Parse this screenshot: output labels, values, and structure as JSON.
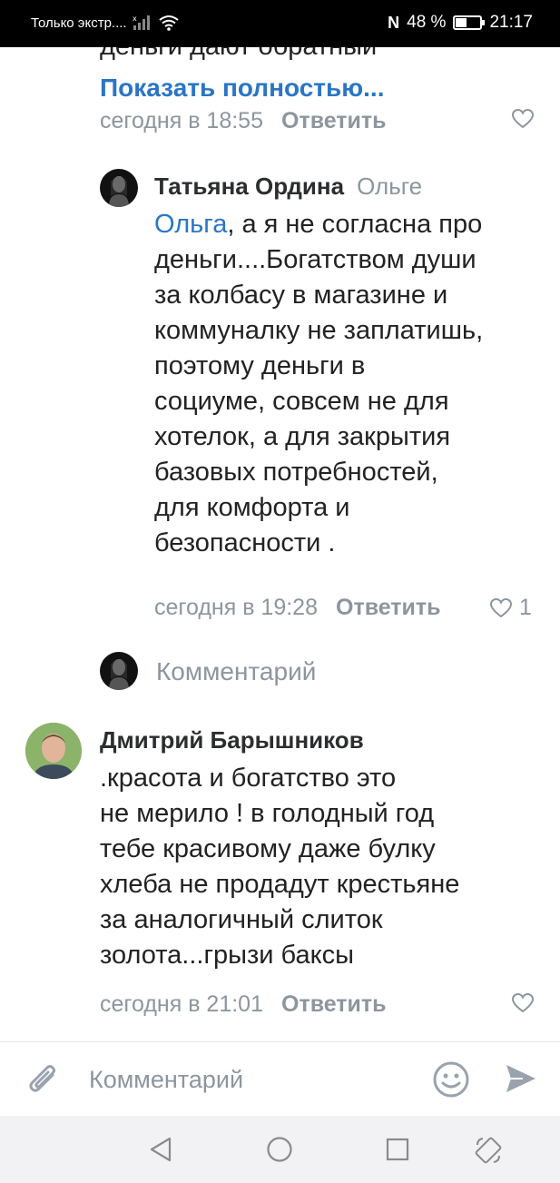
{
  "status_bar": {
    "carrier_text": "Только экстр....",
    "battery_text": "48 %",
    "battery_level": 0.48,
    "time": "21:17"
  },
  "comments": [
    {
      "truncated_line": "деньги дают обратный",
      "show_more": "Показать полностью...",
      "time": "сегодня в 18:55",
      "reply": "Ответить"
    },
    {
      "author": "Татьяна Ордина",
      "to": "Ольге",
      "mention": "Ольга",
      "lines": [
        ", а я не согласна про",
        "деньги....Богатством души",
        "за колбасу в магазине и",
        "коммуналку не заплатишь,",
        "поэтому деньги в",
        "социуме, совсем не для",
        "хотелок, а для закрытия",
        "базовых потребностей,",
        "для комфорта и",
        "безопасности ."
      ],
      "time": "сегодня в 19:28",
      "reply": "Ответить",
      "likes": "1"
    },
    {
      "author": "Дмитрий Барышников",
      "lines": [
        ".красота и богатство это",
        "не мерило ! в голодный год",
        "тебе красивому даже булку",
        "хлеба не продадут крестьяне",
        "за аналогичный слиток",
        "золота...грызи баксы"
      ],
      "time": "сегодня в 21:01",
      "reply": "Ответить"
    }
  ],
  "reply_thread": {
    "placeholder": "Комментарий"
  },
  "comment_bar": {
    "placeholder": "Комментарий"
  },
  "icons": {
    "attach": "paperclip-icon",
    "emoji": "smiley-icon",
    "send": "send-icon",
    "like": "heart-icon",
    "nav_back": "triangle-back-icon",
    "nav_home": "circle-home-icon",
    "nav_recents": "square-recents-icon",
    "nav_rotate": "rotate-icon"
  },
  "colors": {
    "link": "#2a76c6",
    "meta": "#8d959e",
    "text": "#222222"
  }
}
